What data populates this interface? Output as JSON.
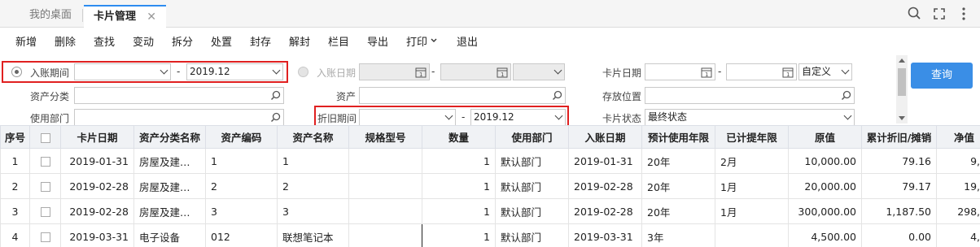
{
  "tabs": [
    {
      "label": "我的桌面"
    },
    {
      "label": "卡片管理",
      "close": "✕"
    }
  ],
  "toolbar": {
    "items": [
      "新增",
      "删除",
      "查找",
      "变动",
      "拆分",
      "处置",
      "封存",
      "解封",
      "栏目",
      "导出",
      "打印",
      "退出"
    ]
  },
  "filter": {
    "posting_period_label": "入账期间",
    "posting_period_from": "",
    "posting_period_to": "2019.12",
    "posting_date_label": "入账日期",
    "asset_category_label": "资产分类",
    "asset_label": "资产",
    "department_label": "使用部门",
    "depreciation_period_label": "折旧期间",
    "depreciation_period_from": "",
    "depreciation_period_to": "2019.12",
    "card_date_label": "卡片日期",
    "card_date_mode": "自定义",
    "storage_location_label": "存放位置",
    "card_status_label": "卡片状态",
    "card_status_value": "最终状态",
    "dash": "-",
    "search_button": "查询"
  },
  "colors": {
    "accent": "#2d8cf0",
    "button": "#3a8ee6",
    "highlight_box": "#e02020"
  },
  "table": {
    "headers": [
      "序号",
      "",
      "卡片日期",
      "资产分类名称",
      "资产编码",
      "资产名称",
      "规格型号",
      "数量",
      "使用部门",
      "入账日期",
      "预计使用年限",
      "已计提年限",
      "原值",
      "累计折旧/摊销",
      "净值"
    ],
    "rows": [
      {
        "no": "1",
        "card_date": "2019-01-31",
        "category": "房屋及建…",
        "code": "1",
        "name": "1",
        "spec": "",
        "qty": "1",
        "dept": "默认部门",
        "post_date": "2019-01-31",
        "life": "20年",
        "used": "2月",
        "orig": "10,000.00",
        "accum": "79.16",
        "net": "9,9"
      },
      {
        "no": "2",
        "card_date": "2019-02-28",
        "category": "房屋及建…",
        "code": "2",
        "name": "2",
        "spec": "",
        "qty": "1",
        "dept": "默认部门",
        "post_date": "2019-02-28",
        "life": "20年",
        "used": "1月",
        "orig": "20,000.00",
        "accum": "79.17",
        "net": "19,9"
      },
      {
        "no": "3",
        "card_date": "2019-02-28",
        "category": "房屋及建…",
        "code": "3",
        "name": "3",
        "spec": "",
        "qty": "1",
        "dept": "默认部门",
        "post_date": "2019-02-28",
        "life": "20年",
        "used": "1月",
        "orig": "300,000.00",
        "accum": "1,187.50",
        "net": "298,8"
      },
      {
        "no": "4",
        "card_date": "2019-03-31",
        "category": "电子设备",
        "code": "012",
        "name": "联想笔记本",
        "spec": "",
        "qty": "1",
        "dept": "默认部门",
        "post_date": "2019-03-31",
        "life": "3年",
        "used": "",
        "orig": "4,500.00",
        "accum": "0.00",
        "net": "4,5"
      }
    ]
  }
}
